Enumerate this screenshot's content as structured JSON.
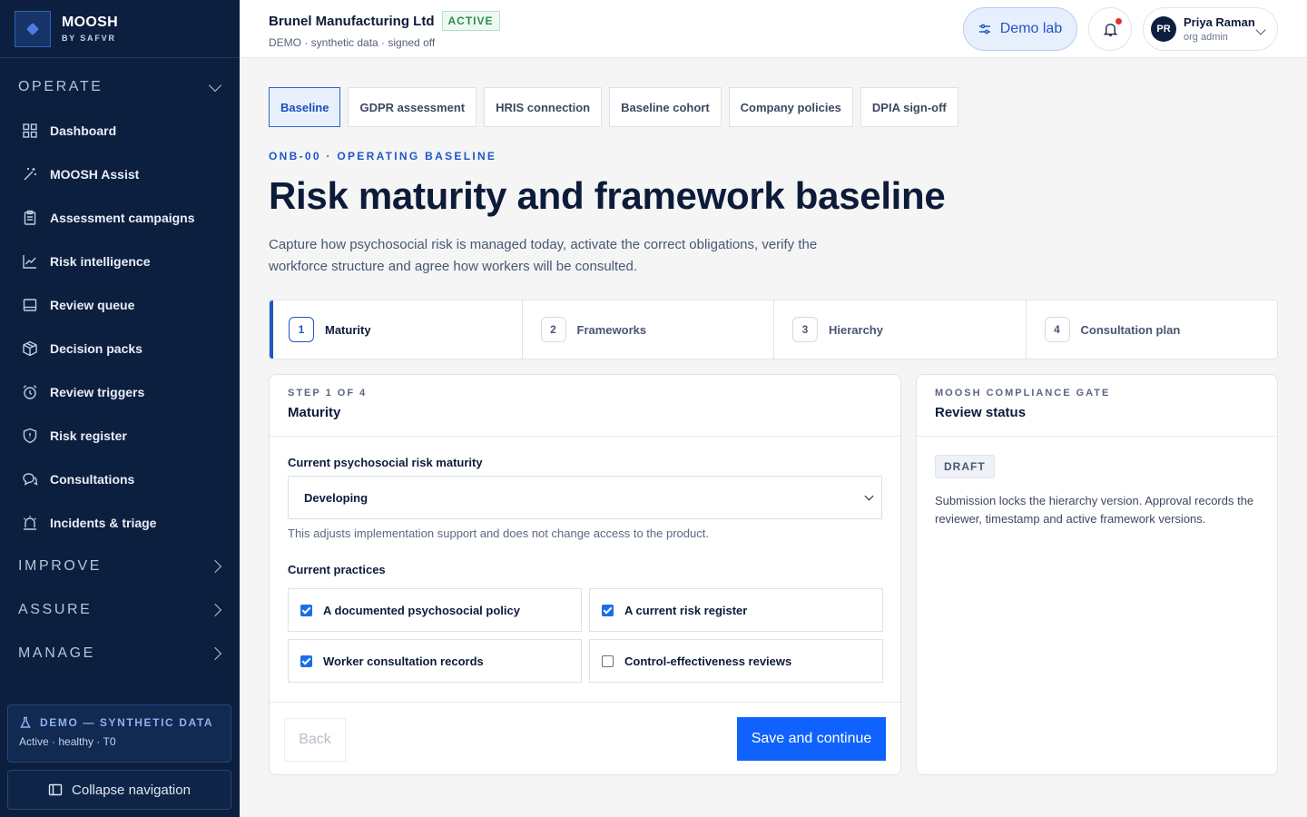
{
  "brand": {
    "name": "MOOSH",
    "sub": "BY SAFVR"
  },
  "nav": {
    "operate_label": "OPERATE",
    "items": [
      {
        "label": "Dashboard",
        "icon": "grid-icon"
      },
      {
        "label": "MOOSH Assist",
        "icon": "magic-wand-icon"
      },
      {
        "label": "Assessment campaigns",
        "icon": "clipboard-icon"
      },
      {
        "label": "Risk intelligence",
        "icon": "chart-line-icon"
      },
      {
        "label": "Review queue",
        "icon": "inbox-icon"
      },
      {
        "label": "Decision packs",
        "icon": "package-icon"
      },
      {
        "label": "Review triggers",
        "icon": "alarm-clock-icon"
      },
      {
        "label": "Risk register",
        "icon": "shield-icon"
      },
      {
        "label": "Consultations",
        "icon": "chat-bubbles-icon"
      },
      {
        "label": "Incidents & triage",
        "icon": "siren-icon"
      }
    ],
    "improve_label": "IMPROVE",
    "assure_label": "ASSURE",
    "manage_label": "MANAGE",
    "demo_title": "DEMO — SYNTHETIC DATA",
    "demo_sub": "Active · healthy · T0",
    "collapse_label": "Collapse navigation"
  },
  "header": {
    "org_name": "Brunel Manufacturing Ltd",
    "status": "ACTIVE",
    "meta": "DEMO · synthetic data · signed off",
    "demo_lab": "Demo lab",
    "user_initials": "PR",
    "user_name": "Priya Raman",
    "user_role": "org admin"
  },
  "tabs": [
    "Baseline",
    "GDPR assessment",
    "HRIS connection",
    "Baseline cohort",
    "Company policies",
    "DPIA sign-off"
  ],
  "page": {
    "eyebrow": "ONB-00 · OPERATING BASELINE",
    "title": "Risk maturity and framework baseline",
    "intro": "Capture how psychosocial risk is managed today, activate the correct obligations, verify the workforce structure and agree how workers will be consulted."
  },
  "steps": [
    {
      "num": "1",
      "label": "Maturity"
    },
    {
      "num": "2",
      "label": "Frameworks"
    },
    {
      "num": "3",
      "label": "Hierarchy"
    },
    {
      "num": "4",
      "label": "Consultation plan"
    }
  ],
  "form": {
    "eyebrow": "STEP 1 OF 4",
    "title": "Maturity",
    "maturity_label": "Current psychosocial risk maturity",
    "maturity_value": "Developing",
    "hint": "This adjusts implementation support and does not change access to the product.",
    "practices_label": "Current practices",
    "practices": [
      {
        "label": "A documented psychosocial policy",
        "checked": true
      },
      {
        "label": "A current risk register",
        "checked": true
      },
      {
        "label": "Worker consultation records",
        "checked": true
      },
      {
        "label": "Control-effectiveness reviews",
        "checked": false
      }
    ],
    "back_label": "Back",
    "save_label": "Save and continue"
  },
  "gate": {
    "eyebrow": "MOOSH COMPLIANCE GATE",
    "title": "Review status",
    "badge": "DRAFT",
    "text": "Submission locks the hierarchy version. Approval records the reviewer, timestamp and active framework versions."
  }
}
